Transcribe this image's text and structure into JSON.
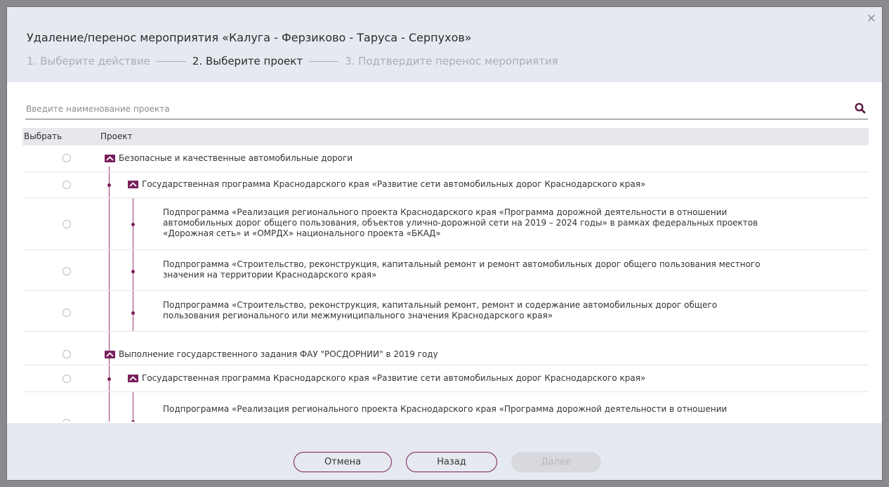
{
  "dialog": {
    "title": "Удаление/перенос мероприятия «Калуга - Ферзиково - Таруса - Серпухов»",
    "close_label": "×",
    "steps": [
      "1. Выберите действие",
      "2. Выберите проект",
      "3. Подтвердите перенос мероприятия"
    ],
    "active_step": 2
  },
  "search": {
    "placeholder": "Введите наименование проекта",
    "value": "",
    "icon": "search-icon"
  },
  "table": {
    "headers": {
      "select": "Выбрать",
      "project": "Проект"
    },
    "rows": [
      {
        "level": 0,
        "label": "Безопасные и качественные автомобильные дороги",
        "selected": false,
        "expanded": true
      },
      {
        "level": 1,
        "label": "Государственная программа Краснодарского края «Развитие сети автомобильных дорог Краснодарского края»",
        "selected": false,
        "expanded": true
      },
      {
        "level": 2,
        "lines": [
          "Подпрограмма «Реализация регионального проекта Краснодарского края «Программа дорожной деятельности в отношении",
          "автомобильных дорог общего пользования, объектов улично-дорожной сети на 2019 – 2024 годы» в рамках федеральных проектов",
          "«Дорожная сеть» и «ОМРДХ» национального проекта «БКАД»"
        ],
        "selected": false
      },
      {
        "level": 2,
        "lines": [
          "Подпрограмма «Строительство, реконструкция, капитальный ремонт и ремонт автомобильных дорог общего пользования местного",
          "значения на территории Краснодарского края»"
        ],
        "selected": false
      },
      {
        "level": 2,
        "lines": [
          "Подпрограмма «Строительство, реконструкция, капитальный ремонт, ремонт и содержание автомобильных дорог общего",
          "пользования регионального или межмуниципального значения Краснодарского края»"
        ],
        "selected": false
      },
      {
        "level": 0,
        "label": "Выполнение государственного задания ФАУ \"РОСДОРНИИ\" в 2019 году",
        "selected": false,
        "expanded": true
      },
      {
        "level": 1,
        "label": "Государственная программа Краснодарского края «Развитие сети автомобильных дорог Краснодарского края»",
        "selected": false,
        "expanded": true
      },
      {
        "level": 2,
        "lines": [
          "Подпрограмма «Реализация регионального проекта Краснодарского края «Программа дорожной деятельности в отношении"
        ],
        "selected": false
      }
    ]
  },
  "footer": {
    "cancel_label": "Отмена",
    "back_label": "Назад",
    "next_label": "Далее"
  },
  "colors": {
    "accent": "#7a1f5c",
    "header_bg": "#e6e9f0",
    "table_header_bg": "#e6e8ec"
  }
}
